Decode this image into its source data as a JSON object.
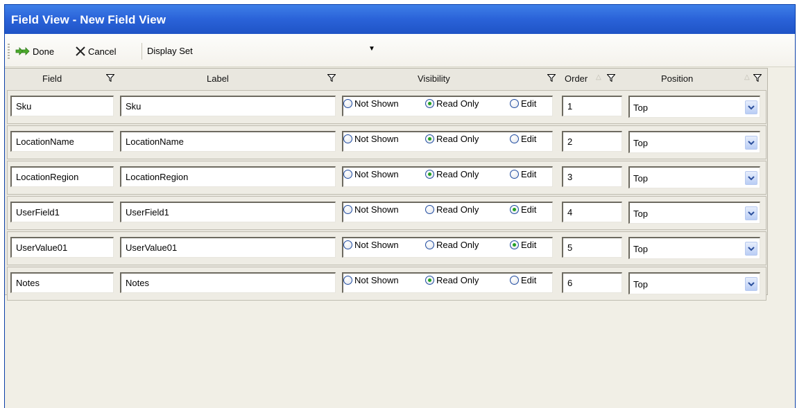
{
  "window": {
    "title": "Field View  - New Field View"
  },
  "toolbar": {
    "done_label": "Done",
    "cancel_label": "Cancel",
    "display_set_label": "Display Set"
  },
  "columns": {
    "field": "Field",
    "label": "Label",
    "visibility": "Visibility",
    "order": "Order",
    "position": "Position"
  },
  "visibility_options": [
    "Not Shown",
    "Read Only",
    "Edit"
  ],
  "rows": [
    {
      "field": "Sku",
      "label": "Sku",
      "visibility": "Read Only",
      "order": "1",
      "position": "Top"
    },
    {
      "field": "LocationName",
      "label": "LocationName",
      "visibility": "Read Only",
      "order": "2",
      "position": "Top"
    },
    {
      "field": "LocationRegion",
      "label": "LocationRegion",
      "visibility": "Read Only",
      "order": "3",
      "position": "Top"
    },
    {
      "field": "UserField1",
      "label": "UserField1",
      "visibility": "Edit",
      "order": "4",
      "position": "Top"
    },
    {
      "field": "UserValue01",
      "label": "UserValue01",
      "visibility": "Edit",
      "order": "5",
      "position": "Top"
    },
    {
      "field": "Notes",
      "label": "Notes",
      "visibility": "Read Only",
      "order": "6",
      "position": "Top"
    }
  ],
  "colors": {
    "titlebar": "#2a62d8",
    "radio_dot": "#21a121",
    "panel": "#f1efe6"
  }
}
